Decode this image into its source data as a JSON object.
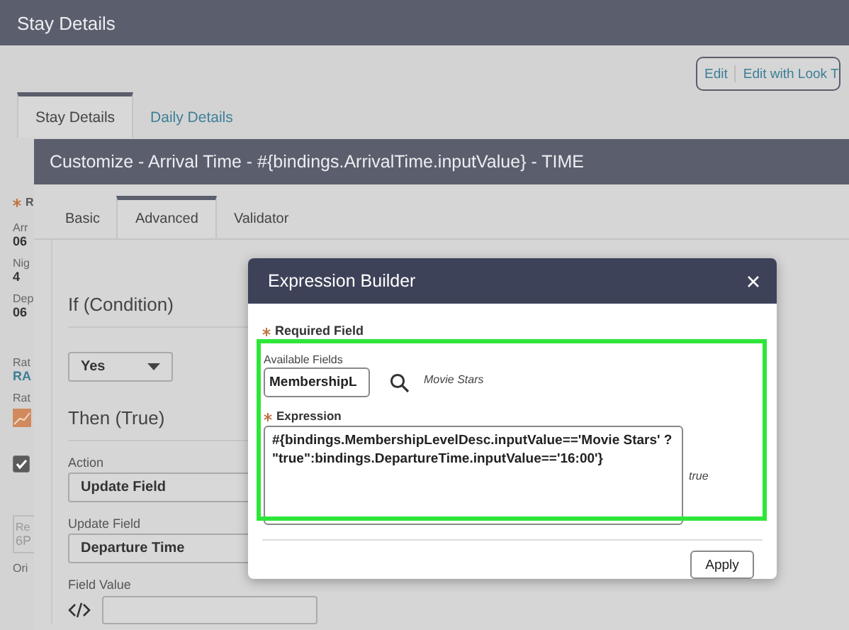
{
  "page": {
    "title": "Stay Details",
    "actions": [
      "Edit",
      "Edit with Look T"
    ],
    "tabs": [
      {
        "label": "Stay Details",
        "selected": true
      },
      {
        "label": "Daily Details",
        "selected": false
      }
    ],
    "side_items": [
      {
        "kind": "required",
        "text": "R"
      },
      {
        "kind": "label",
        "text": "Arr"
      },
      {
        "kind": "value",
        "text": "06"
      },
      {
        "kind": "label",
        "text": "Nig"
      },
      {
        "kind": "value",
        "text": "4"
      },
      {
        "kind": "label",
        "text": "Dep"
      },
      {
        "kind": "value",
        "text": "06"
      },
      {
        "kind": "gap"
      },
      {
        "kind": "label",
        "text": "Rat"
      },
      {
        "kind": "link",
        "text": "RA"
      },
      {
        "kind": "label",
        "text": "Rat"
      },
      {
        "kind": "chart"
      },
      {
        "kind": "checkbox",
        "checked": true
      },
      {
        "kind": "boxlabel",
        "text": "Re"
      },
      {
        "kind": "boxvalue",
        "text": "6P"
      },
      {
        "kind": "label",
        "text": "Ori"
      }
    ]
  },
  "customize": {
    "title": "Customize - Arrival Time - #{bindings.ArrivalTime.inputValue} - TIME",
    "tabs": [
      {
        "label": "Basic",
        "selected": false
      },
      {
        "label": "Advanced",
        "selected": true
      },
      {
        "label": "Validator",
        "selected": false
      }
    ],
    "condition_heading": "If (Condition)",
    "condition": "Yes",
    "then_heading": "Then (True)",
    "fields": [
      {
        "label": "Action",
        "value": "Update Field"
      },
      {
        "label": "Update Field",
        "value": "Departure Time"
      }
    ],
    "field_value_label": "Field Value"
  },
  "expression_builder": {
    "title": "Expression Builder",
    "required_note": "Required Field",
    "available_fields_label": "Available Fields",
    "available_field": "MembershipL",
    "field_sample": "Movie Stars",
    "expression_label": "Expression",
    "expression": "#{bindings.MembershipLevelDesc.inputValue=='Movie Stars' ? \"true\":bindings.DepartureTime.inputValue=='16:00'}",
    "result": "true",
    "apply": "Apply"
  }
}
